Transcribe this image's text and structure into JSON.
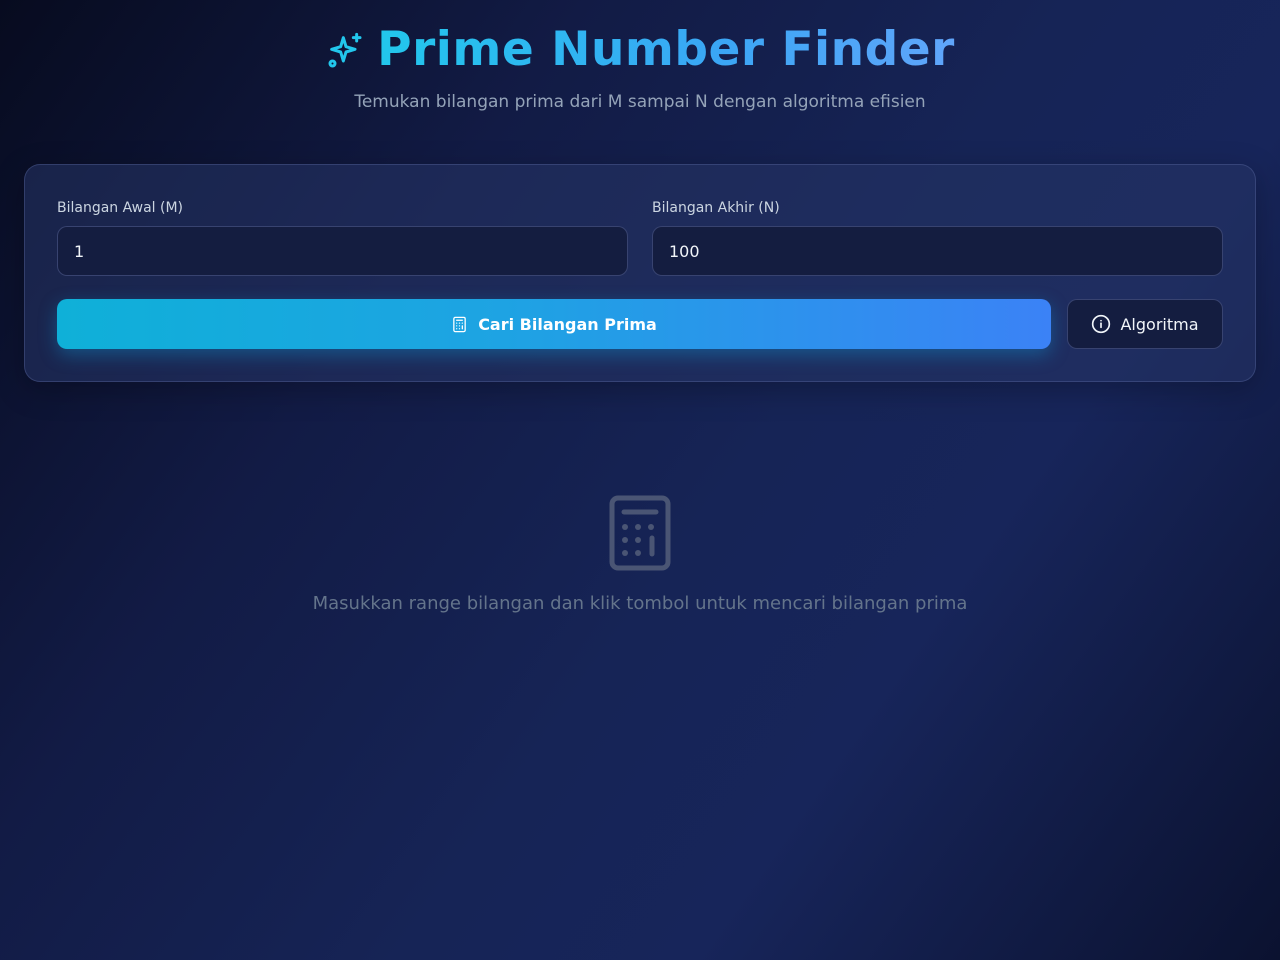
{
  "header": {
    "icon": "sparkles-icon",
    "title": "Prime Number Finder",
    "subtitle": "Temukan bilangan prima dari M sampai N dengan algoritma efisien"
  },
  "form": {
    "start": {
      "label": "Bilangan Awal (M)",
      "value": "1"
    },
    "end": {
      "label": "Bilangan Akhir (N)",
      "value": "100"
    },
    "search_button": {
      "label": "Cari Bilangan Prima",
      "icon": "calculator-icon"
    },
    "algorithm_button": {
      "label": "Algoritma",
      "icon": "info-icon"
    }
  },
  "empty_state": {
    "icon": "calculator-icon",
    "message": "Masukkan range bilangan dan klik tombol untuk mencari bilangan prima"
  },
  "colors": {
    "accent_start": "#0fb0d8",
    "accent_end": "#3b82f6",
    "title_cyan": "#22c7ec",
    "muted_text": "#94a3b8"
  }
}
